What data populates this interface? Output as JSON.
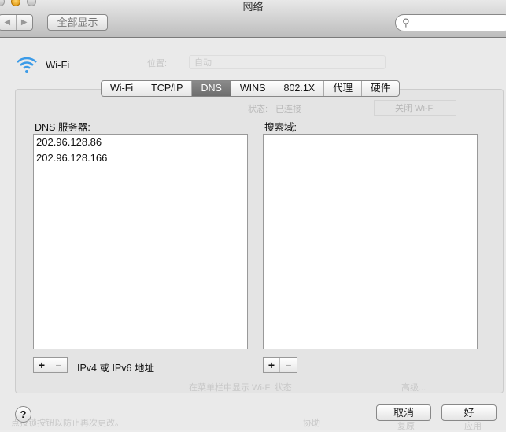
{
  "window": {
    "title": "网络"
  },
  "toolbar": {
    "back": "◀",
    "forward": "▶",
    "show_all": "全部显示",
    "search_placeholder": ""
  },
  "header": {
    "service": "Wi-Fi",
    "location_label": "位置:",
    "location_value": "自动"
  },
  "background": {
    "status_label": "状态:",
    "status_value": "已连接",
    "turn_off": "关闭 Wi-Fi",
    "show_menu": "在菜单栏中显示 Wi-Fi 状态",
    "advanced": "高级...",
    "lock_text": "点按锁按钮以防止再次更改。",
    "assist": "协助",
    "revert": "复原",
    "apply": "应用"
  },
  "tabs": [
    {
      "label": "Wi-Fi"
    },
    {
      "label": "TCP/IP"
    },
    {
      "label": "DNS",
      "active": true
    },
    {
      "label": "WINS"
    },
    {
      "label": "802.1X"
    },
    {
      "label": "代理"
    },
    {
      "label": "硬件"
    }
  ],
  "dns": {
    "label": "DNS 服务器:",
    "servers": [
      "202.96.128.86",
      "202.96.128.166"
    ],
    "hint": "IPv4 或 IPv6 地址",
    "add": "+",
    "remove": "−"
  },
  "search_domains": {
    "label": "搜索域:",
    "items": [],
    "add": "+",
    "remove": "−"
  },
  "footer": {
    "help": "?",
    "cancel": "取消",
    "ok": "好"
  }
}
